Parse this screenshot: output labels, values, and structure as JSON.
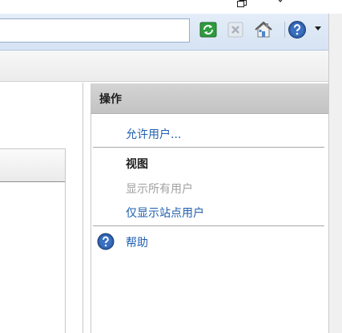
{
  "address_bar": {
    "value": ""
  },
  "actions_pane": {
    "title": "操作",
    "allow_user_link": "允许用户...",
    "view_group_title": "视图",
    "show_all_users": "显示所有用户",
    "show_site_users_link": "仅显示站点用户",
    "help_link": "帮助"
  },
  "toolbar_icons": [
    "refresh-icon",
    "stop-icon",
    "home-icon",
    "help-icon",
    "dropdown-arrow-icon"
  ],
  "colors": {
    "link": "#1f5fb0",
    "disabled": "#a0a0a0",
    "header": "#c9c9c9"
  }
}
